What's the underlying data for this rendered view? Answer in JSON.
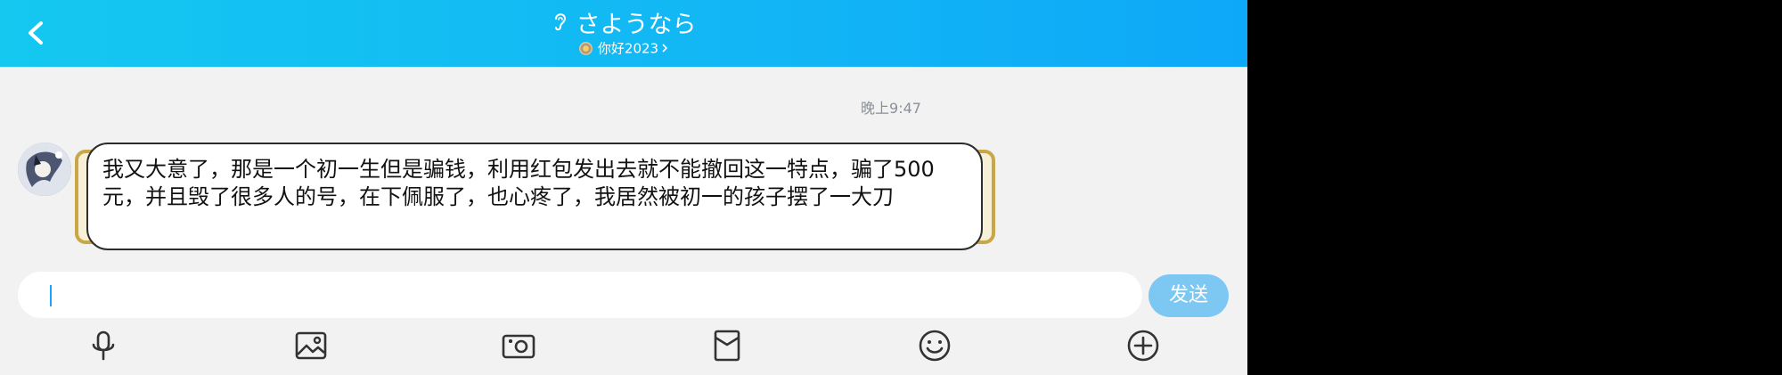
{
  "header": {
    "title": "さようなら",
    "subtitle": "你好2023",
    "icons": {
      "back": "back-arrow-icon",
      "title": "ear-icon",
      "subtitle": "flower-icon",
      "chevron": "chevron-right-icon"
    }
  },
  "chat": {
    "timestamp": "晚上9:47",
    "message": {
      "text": "我又大意了，那是一个初一生但是骗钱，利用红包发出去就不能撤回这一特点，骗了500元，并且毁了很多人的号，在下佩服了，也心疼了，我居然被初一的孩子摆了一大刀"
    }
  },
  "input": {
    "value": "",
    "send_label": "发送"
  },
  "toolbar": {
    "items": [
      "microphone-icon",
      "image-icon",
      "camera-icon",
      "red-packet-icon",
      "emoji-icon",
      "plus-icon"
    ]
  },
  "colors": {
    "header_start": "#14c8f0",
    "header_end": "#0ea8f8",
    "send_button": "#7cc8f2",
    "bubble_border": "#c9a747"
  }
}
